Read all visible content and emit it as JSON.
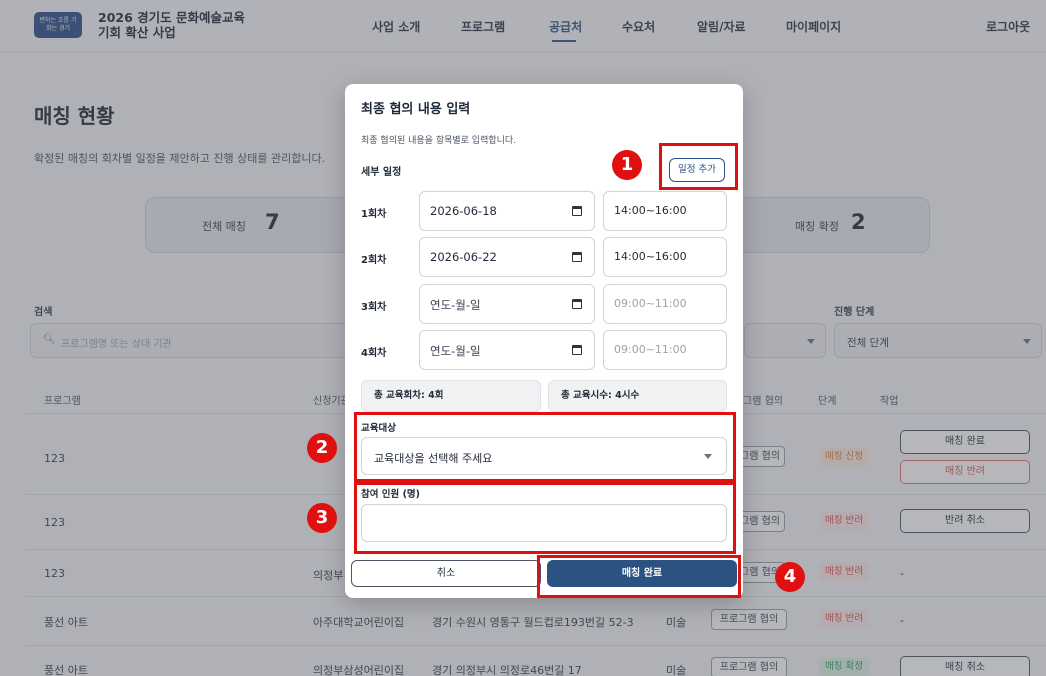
{
  "header": {
    "logo_text": "변하는 흐름 기회는 경기",
    "brand_line1": "2026 경기도 문화예술교육",
    "brand_line2": "기회 확산 사업",
    "nav": [
      "사업 소개",
      "프로그램",
      "공급처",
      "수요처",
      "알림/자료",
      "마이페이지"
    ],
    "active_nav": "공급처",
    "logout": "로그아웃"
  },
  "page": {
    "title": "매칭 현황",
    "description": "확정된 매칭의 회차별 일정을 제안하고 진행 상태를 관리합니다.",
    "stats": [
      {
        "label": "전체 매칭",
        "value": "7"
      },
      {
        "label": "매칭 확정",
        "value": "2"
      }
    ],
    "filters": {
      "search_label": "검색",
      "search_placeholder": "프로그램명 또는 상대 기관",
      "stage_label": "진행 단계",
      "stage_value": "전체 단계"
    },
    "table": {
      "headers": [
        "프로그램",
        "신청기관",
        "그램 협의",
        "단계",
        "작업"
      ],
      "rows": [
        {
          "program": "123",
          "org": "",
          "address": "",
          "genre": "",
          "discussion": "그램 협의",
          "stage": "매칭 신청",
          "stage_color": "#e07b39",
          "actions": [
            "매칭 완료",
            "매칭 반려"
          ]
        },
        {
          "program": "123",
          "org": "",
          "address": "",
          "genre": "",
          "discussion": "그램 협의",
          "stage": "매칭 반려",
          "stage_color": "#d9534f",
          "actions": [
            "반려 취소"
          ]
        },
        {
          "program": "123",
          "org": "의정부",
          "address": "",
          "genre": "",
          "discussion": "그램 협의",
          "stage": "매칭 반려",
          "stage_color": "#d9534f",
          "actions": [
            "-"
          ]
        },
        {
          "program": "풍선 아트",
          "org": "아주대학교어린이집",
          "address": "경기 수원시 영통구 월드컵로193번길 52-3",
          "genre": "미술",
          "discussion": "프로그램 협의",
          "stage": "매칭 반려",
          "stage_color": "#d9534f",
          "actions": [
            "-"
          ]
        },
        {
          "program": "풍선 아트",
          "org": "의정부삼성어린이집",
          "address": "경기 의정부시 의정로46번길 17",
          "genre": "미술",
          "discussion": "프로그램 협의",
          "stage": "매칭 확정",
          "stage_color": "#2f9e5b",
          "actions": [
            "매칭 취소"
          ]
        }
      ]
    }
  },
  "modal": {
    "title": "최종 협의 내용 입력",
    "description": "최종 협의된 내용을 항목별로 입력합니다.",
    "schedule_label": "세부 일정",
    "add_schedule_button": "일정 추가",
    "sessions": [
      {
        "label": "1회차",
        "date": "2026-06-18",
        "time": "14:00~16:00",
        "date_placeholder": false,
        "time_placeholder": false
      },
      {
        "label": "2회차",
        "date": "2026-06-22",
        "time": "14:00~16:00",
        "date_placeholder": false,
        "time_placeholder": false
      },
      {
        "label": "3회차",
        "date": "연도-월-일",
        "time": "09:00~11:00",
        "date_placeholder": true,
        "time_placeholder": true
      },
      {
        "label": "4회차",
        "date": "연도-월-일",
        "time": "09:00~11:00",
        "date_placeholder": true,
        "time_placeholder": true
      }
    ],
    "total_sessions": "총 교육회차: 4회",
    "total_hours": "총 교육시수: 4시수",
    "target_label": "교육대상",
    "target_placeholder": "교육대상을 선택해 주세요",
    "participants_label": "참여 인원 (명)",
    "participants_value": "",
    "cancel_button": "취소",
    "confirm_button": "매칭 완료"
  },
  "annotations": [
    "1",
    "2",
    "3",
    "4"
  ],
  "colors": {
    "primary": "#2c5282",
    "highlight": "#e01010"
  }
}
